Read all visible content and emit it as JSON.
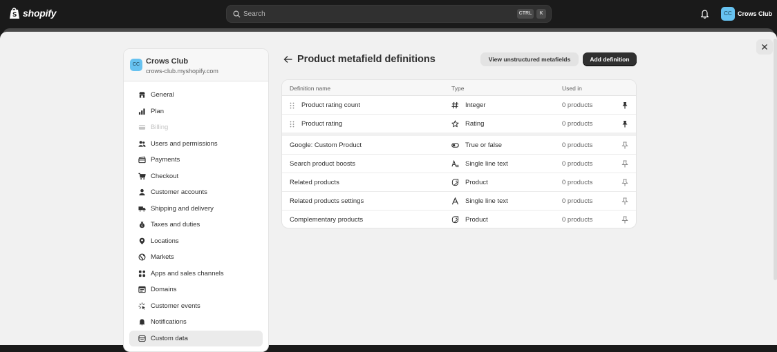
{
  "topbar": {
    "logo_text": "shopify",
    "search_placeholder": "Search",
    "shortcut_ctrl": "CTRL",
    "shortcut_k": "K",
    "store_initials": "CC",
    "store_name": "Crows Club"
  },
  "sidebar": {
    "store_initials": "CC",
    "store_name": "Crows Club",
    "store_url": "crows-club.myshopify.com",
    "items": [
      {
        "label": "General",
        "icon": "store-icon",
        "state": "normal"
      },
      {
        "label": "Plan",
        "icon": "plan-icon",
        "state": "normal"
      },
      {
        "label": "Billing",
        "icon": "billing-icon",
        "state": "disabled"
      },
      {
        "label": "Users and permissions",
        "icon": "users-icon",
        "state": "normal"
      },
      {
        "label": "Payments",
        "icon": "payments-icon",
        "state": "normal"
      },
      {
        "label": "Checkout",
        "icon": "cart-icon",
        "state": "normal"
      },
      {
        "label": "Customer accounts",
        "icon": "person-icon",
        "state": "normal"
      },
      {
        "label": "Shipping and delivery",
        "icon": "truck-icon",
        "state": "normal"
      },
      {
        "label": "Taxes and duties",
        "icon": "tax-bag-icon",
        "state": "normal"
      },
      {
        "label": "Locations",
        "icon": "location-pin-icon",
        "state": "normal"
      },
      {
        "label": "Markets",
        "icon": "globe-icon",
        "state": "normal"
      },
      {
        "label": "Apps and sales channels",
        "icon": "apps-icon",
        "state": "normal"
      },
      {
        "label": "Domains",
        "icon": "domains-icon",
        "state": "normal"
      },
      {
        "label": "Customer events",
        "icon": "sparkle-icon",
        "state": "normal"
      },
      {
        "label": "Notifications",
        "icon": "bell-icon",
        "state": "normal"
      },
      {
        "label": "Custom data",
        "icon": "custom-data-icon",
        "state": "active"
      }
    ]
  },
  "main": {
    "title": "Product metafield definitions",
    "secondary_button": "View unstructured metafields",
    "primary_button": "Add definition",
    "columns": [
      "Definition name",
      "Type",
      "Used in"
    ],
    "rows": [
      {
        "name": "Product rating count",
        "type": "Integer",
        "type_icon": "hash-icon",
        "used": "0 products",
        "pinned": true,
        "draggable": true
      },
      {
        "name": "Product rating",
        "type": "Rating",
        "type_icon": "star-icon",
        "used": "0 products",
        "pinned": true,
        "draggable": true
      },
      {
        "name": "Google: Custom Product",
        "type": "True or false",
        "type_icon": "toggle-icon",
        "used": "0 products",
        "pinned": false,
        "draggable": false
      },
      {
        "name": "Search product boosts",
        "type": "Single line text",
        "type_icon": "text-list-icon",
        "used": "0 products",
        "pinned": false,
        "draggable": false
      },
      {
        "name": "Related products",
        "type": "Product",
        "type_icon": "product-tag-icon",
        "used": "0 products",
        "pinned": false,
        "draggable": false
      },
      {
        "name": "Related products settings",
        "type": "Single line text",
        "type_icon": "text-icon",
        "used": "0 products",
        "pinned": false,
        "draggable": false
      },
      {
        "name": "Complementary products",
        "type": "Product",
        "type_icon": "product-tag-icon",
        "used": "0 products",
        "pinned": false,
        "draggable": false
      }
    ]
  },
  "colors": {
    "topbar_bg": "#1a1a1a",
    "page_bg": "#f1f1f1",
    "primary_button_bg": "#303030",
    "avatar_bg": "#67c2f0"
  }
}
